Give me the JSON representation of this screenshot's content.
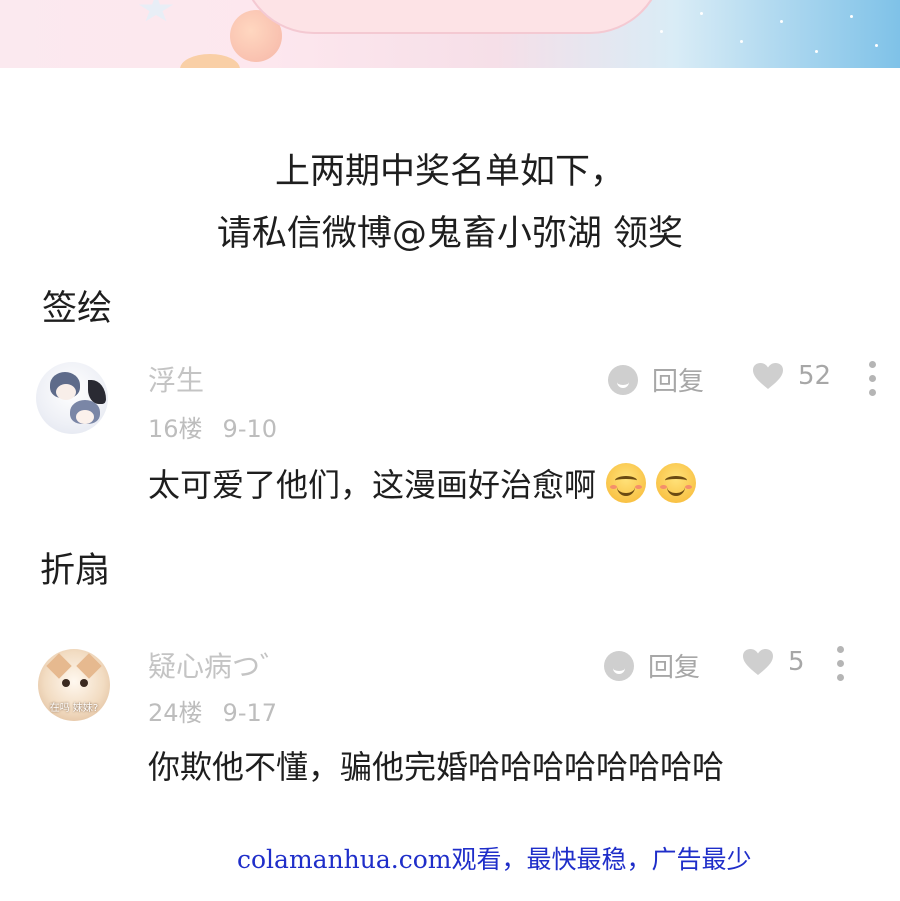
{
  "notice": {
    "line1": "上两期中奖名单如下，",
    "line2": "请私信微博@鬼畜小弥湖 领奖"
  },
  "sections": [
    {
      "title": "签绘",
      "comment": {
        "avatar": "anime-couple-avatar",
        "username": "浮生",
        "floor": "16楼",
        "date": "9-10",
        "reply_label": "回复",
        "likes": "52",
        "text": "太可爱了他们，这漫画好治愈啊",
        "emojis": [
          "smiling-face-emoji",
          "smiling-face-emoji"
        ]
      }
    },
    {
      "title": "折扇",
      "comment": {
        "avatar": "cat-avatar",
        "avatar_caption": "在吗 妹妹?",
        "username": "疑心病つ゛",
        "floor": "24楼",
        "date": "9-17",
        "reply_label": "回复",
        "likes": "5",
        "text": "你欺他不懂，骗他完婚哈哈哈哈哈哈哈哈",
        "emojis": []
      }
    }
  ],
  "footer": "colamanhua.com观看，最快最稳，广告最少",
  "colors": {
    "footer_link": "#1f2ec9",
    "muted_text": "#bdbdbd",
    "icon_gray": "#cfcfcf"
  }
}
